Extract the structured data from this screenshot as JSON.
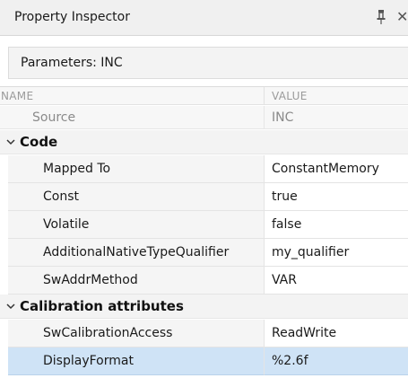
{
  "panel": {
    "title": "Property Inspector"
  },
  "params": {
    "label": "Parameters: INC"
  },
  "table": {
    "header": {
      "name": "NAME",
      "value": "VALUE"
    },
    "source": {
      "name": "Source",
      "value": "INC"
    },
    "groups": [
      {
        "label": "Code",
        "rows": [
          {
            "name": "Mapped To",
            "value": "ConstantMemory"
          },
          {
            "name": "Const",
            "value": "true"
          },
          {
            "name": "Volatile",
            "value": "false"
          },
          {
            "name": "AdditionalNativeTypeQualifier",
            "value": "my_qualifier"
          },
          {
            "name": "SwAddrMethod",
            "value": "VAR"
          }
        ]
      },
      {
        "label": "Calibration attributes",
        "rows": [
          {
            "name": "SwCalibrationAccess",
            "value": "ReadWrite"
          },
          {
            "name": "DisplayFormat",
            "value": "%2.6f"
          }
        ]
      }
    ]
  },
  "icons": {
    "pin": "pin-icon",
    "close": "close-icon",
    "expand": "chevron-down-icon"
  },
  "colors": {
    "selected_row": "#cfe3f6",
    "group_bg": "#f3f3f3",
    "header_text": "#9a9a9a"
  }
}
